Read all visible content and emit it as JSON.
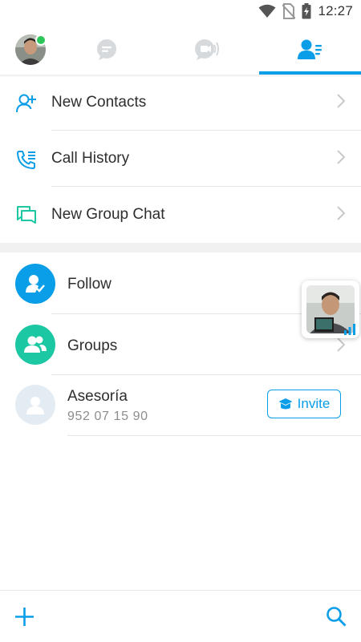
{
  "status_bar": {
    "time": "12:27"
  },
  "tabs": {
    "avatar": "profile-avatar",
    "chats_icon": "chat-bubble-icon",
    "calls_icon": "video-call-icon",
    "contacts_icon": "contacts-list-icon",
    "active_tab": "contacts"
  },
  "menu": {
    "items": [
      {
        "label": "New Contacts",
        "icon": "add-contact-icon"
      },
      {
        "label": "Call History",
        "icon": "call-history-icon"
      },
      {
        "label": "New Group Chat",
        "icon": "group-chat-icon"
      }
    ]
  },
  "contacts": [
    {
      "name": "Follow",
      "icon": "follow-icon",
      "color": "#0a9de8"
    },
    {
      "name": "Groups",
      "icon": "groups-icon",
      "color": "#1cc7a4"
    },
    {
      "name": "Asesoría",
      "phone": "952 07 15 90",
      "icon": "person-placeholder-icon",
      "invite_label": "Invite"
    }
  ],
  "bottom_bar": {
    "add_icon": "plus-icon",
    "search_icon": "search-icon"
  },
  "colors": {
    "accent": "#0a9de8",
    "teal": "#1cc7a4",
    "online": "#2cc65a"
  }
}
